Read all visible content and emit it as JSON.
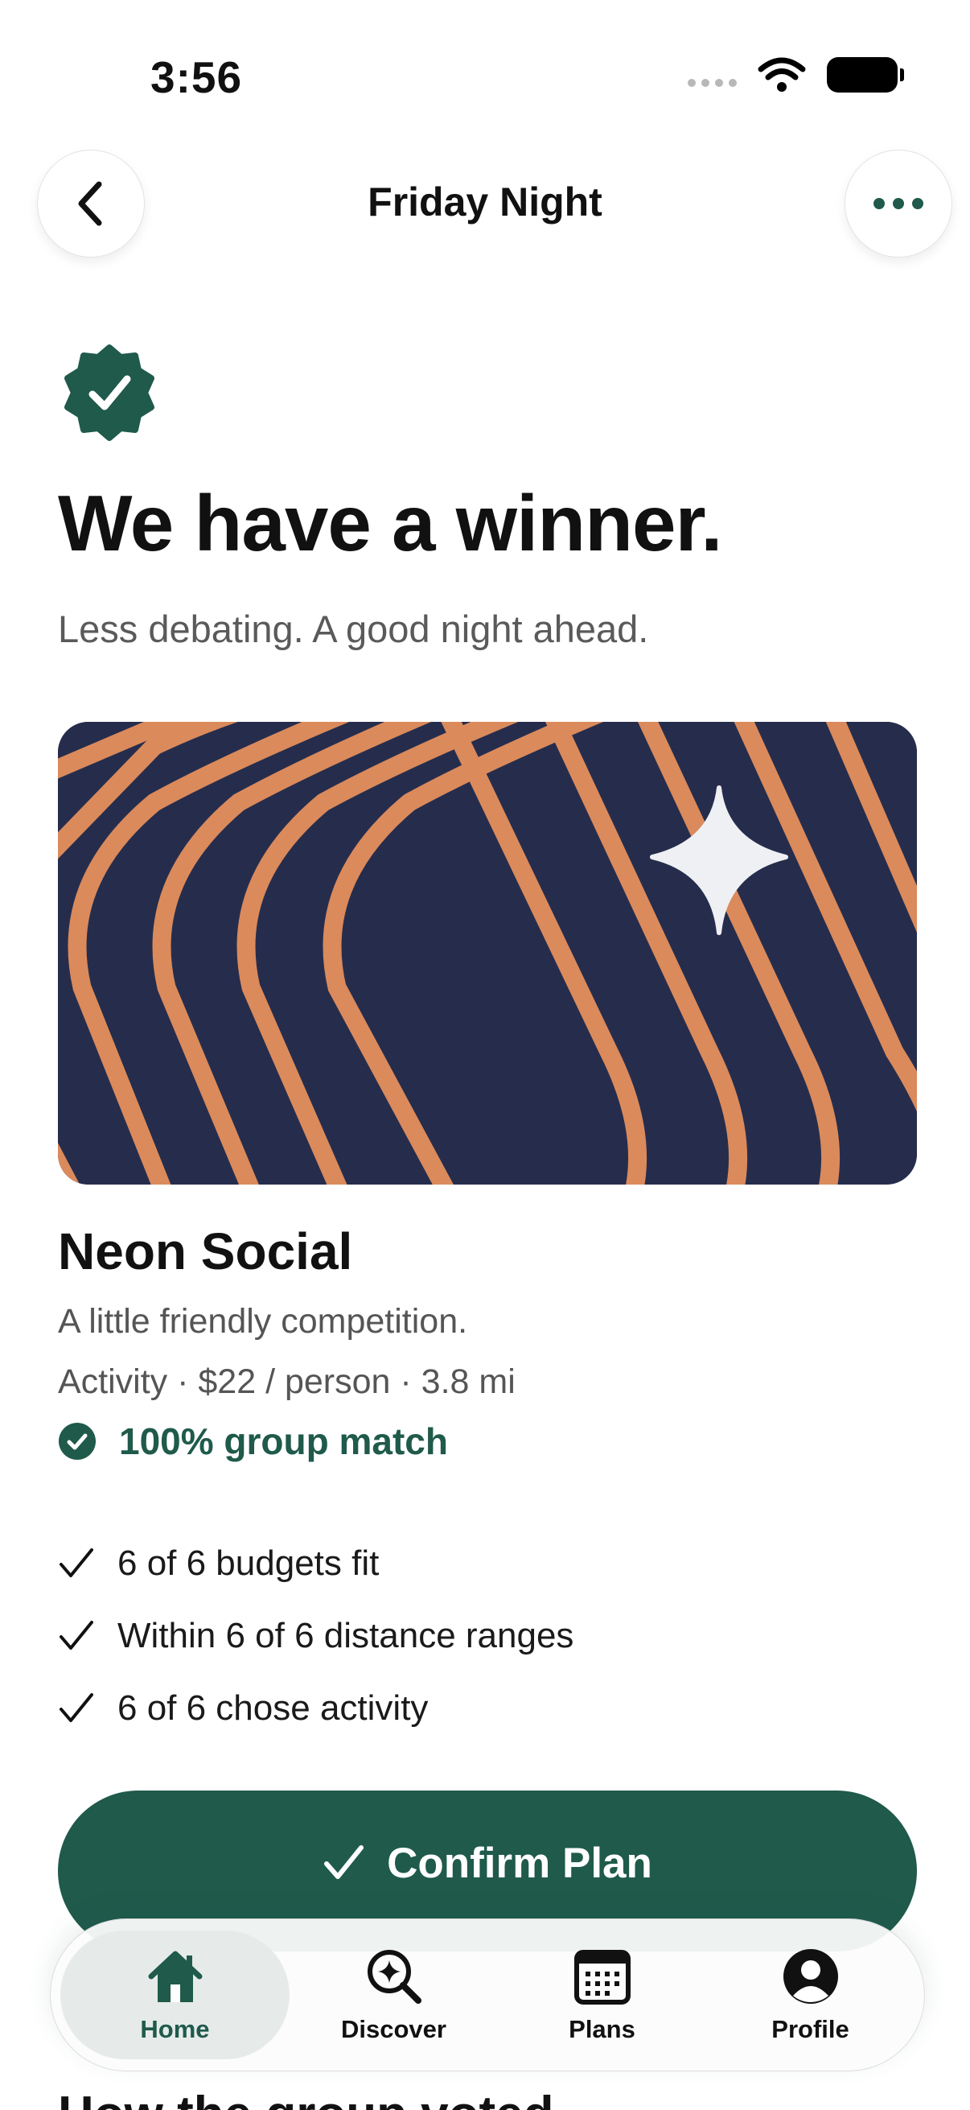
{
  "status_bar": {
    "time": "3:56"
  },
  "header": {
    "title": "Friday Night"
  },
  "winner": {
    "headline": "We have a winner.",
    "subheadline": "Less debating. A good night ahead."
  },
  "place": {
    "name": "Neon Social",
    "tagline": "A little friendly competition.",
    "meta": "Activity · $22 / person · 3.8 mi",
    "match": "100% group match",
    "checks": [
      "6 of 6 budgets fit",
      "Within 6 of 6 distance ranges",
      "6 of 6 chose activity"
    ]
  },
  "actions": {
    "confirm_label": "Confirm Plan"
  },
  "section": {
    "title": "How the group voted"
  },
  "tabs": [
    {
      "label": "Home",
      "icon": "home-icon",
      "active": true
    },
    {
      "label": "Discover",
      "icon": "discover-icon"
    },
    {
      "label": "Plans",
      "icon": "calendar-icon"
    },
    {
      "label": "Profile",
      "icon": "profile-icon"
    }
  ],
  "colors": {
    "accent": "#1f5a4b",
    "hero_bg": "#262d4c",
    "hero_stripe": "#db8a5c"
  }
}
